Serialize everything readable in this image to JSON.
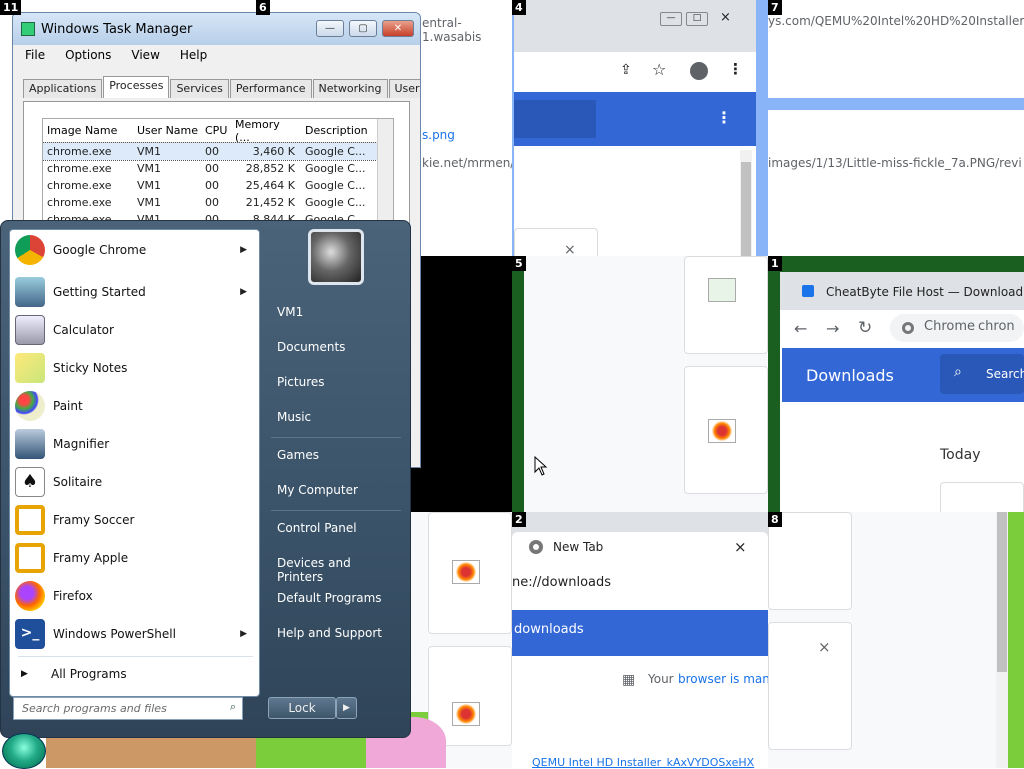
{
  "tiles": {
    "t11": "11",
    "t6": "6",
    "t4": "4",
    "t7": "7",
    "t5": "5",
    "t1": "1",
    "t2": "2",
    "t8": "8",
    "top_url_fragment": "entral-1.wasabis",
    "tile6_png": "s.png",
    "tile6_url2": "kie.net/mrmen/",
    "tile7_url": "ys.com/QEMU%20Intel%20HD%20Installer_",
    "tile7_url2": "images/1/13/Little-miss-fickle_7a.PNG/revi",
    "close_glyph": "×"
  },
  "task_manager": {
    "title": "Windows Task Manager",
    "menu": [
      "File",
      "Options",
      "View",
      "Help"
    ],
    "tabs": [
      "Applications",
      "Processes",
      "Services",
      "Performance",
      "Networking",
      "Users"
    ],
    "columns": [
      "Image Name",
      "User Name",
      "CPU",
      "Memory (...",
      "Description"
    ],
    "rows": [
      [
        "chrome.exe",
        "VM1",
        "00",
        "3,460 K",
        "Google C..."
      ],
      [
        "chrome.exe",
        "VM1",
        "00",
        "28,852 K",
        "Google C..."
      ],
      [
        "chrome.exe",
        "VM1",
        "00",
        "25,464 K",
        "Google C..."
      ],
      [
        "chrome.exe",
        "VM1",
        "00",
        "21,452 K",
        "Google C..."
      ],
      [
        "chrome.exe",
        "VM1",
        "00",
        "8,844 K",
        "Google C..."
      ]
    ]
  },
  "start_menu": {
    "programs": [
      {
        "label": "Google Chrome",
        "icon": "chrome-icon",
        "submenu": true
      },
      {
        "label": "Getting Started",
        "icon": "getting-started-icon",
        "submenu": true
      },
      {
        "label": "Calculator",
        "icon": "calculator-icon",
        "submenu": false
      },
      {
        "label": "Sticky Notes",
        "icon": "sticky-notes-icon",
        "submenu": false
      },
      {
        "label": "Paint",
        "icon": "paint-icon",
        "submenu": false
      },
      {
        "label": "Magnifier",
        "icon": "magnifier-icon",
        "submenu": false
      },
      {
        "label": "Solitaire",
        "icon": "solitaire-icon",
        "submenu": false
      },
      {
        "label": "Framy Soccer",
        "icon": "framy-soccer-icon",
        "submenu": false
      },
      {
        "label": "Framy Apple",
        "icon": "framy-apple-icon",
        "submenu": false
      },
      {
        "label": "Firefox",
        "icon": "firefox-icon",
        "submenu": false
      },
      {
        "label": "Windows PowerShell",
        "icon": "powershell-icon",
        "submenu": true
      }
    ],
    "all_programs": "All Programs",
    "search_placeholder": "Search programs and files",
    "right_items": [
      "VM1",
      "Documents",
      "Pictures",
      "Music",
      "Games",
      "My Computer",
      "Control Panel",
      "Devices and Printers",
      "Default Programs",
      "Help and Support"
    ],
    "lock_label": "Lock"
  },
  "tile1": {
    "tab_title": "CheatByte File Host — Download",
    "omnibox": "Chrome",
    "omnibox_tail": "chron",
    "header": "Downloads",
    "search": "Search",
    "today": "Today"
  },
  "tile2": {
    "tab_title": "New Tab",
    "address": "ne://downloads",
    "header": "downloads",
    "managed": "Your",
    "managed_link": "browser is man",
    "file_link": "QEMU Intel HD Installer_kAxVYDOSxeHX"
  }
}
